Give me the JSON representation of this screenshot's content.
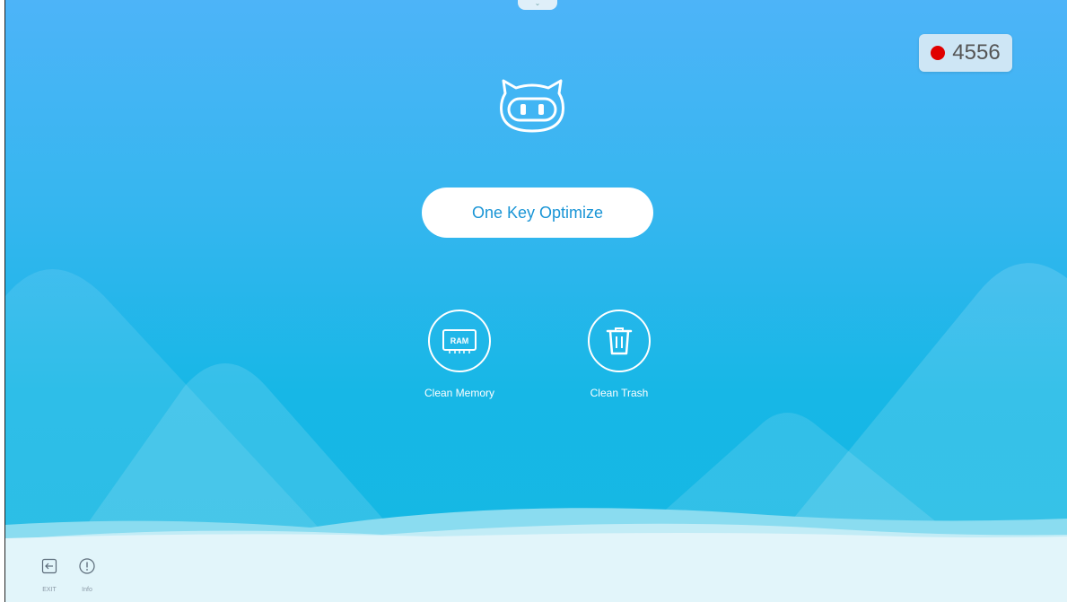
{
  "recording_counter": "4556",
  "main": {
    "optimize_label": "One Key Optimize",
    "tools": [
      {
        "label": "Clean Memory",
        "icon": "ram-chip-icon"
      },
      {
        "label": "Clean Trash",
        "icon": "trash-icon"
      }
    ],
    "ram_text": "RAM"
  },
  "bottom": {
    "exit_label": "EXIT",
    "info_label": "Info"
  },
  "colors": {
    "accent": "#1a95d6",
    "recording": "#e00000",
    "sky_top": "#4db4f8",
    "sky_bottom": "#14b8e3"
  }
}
